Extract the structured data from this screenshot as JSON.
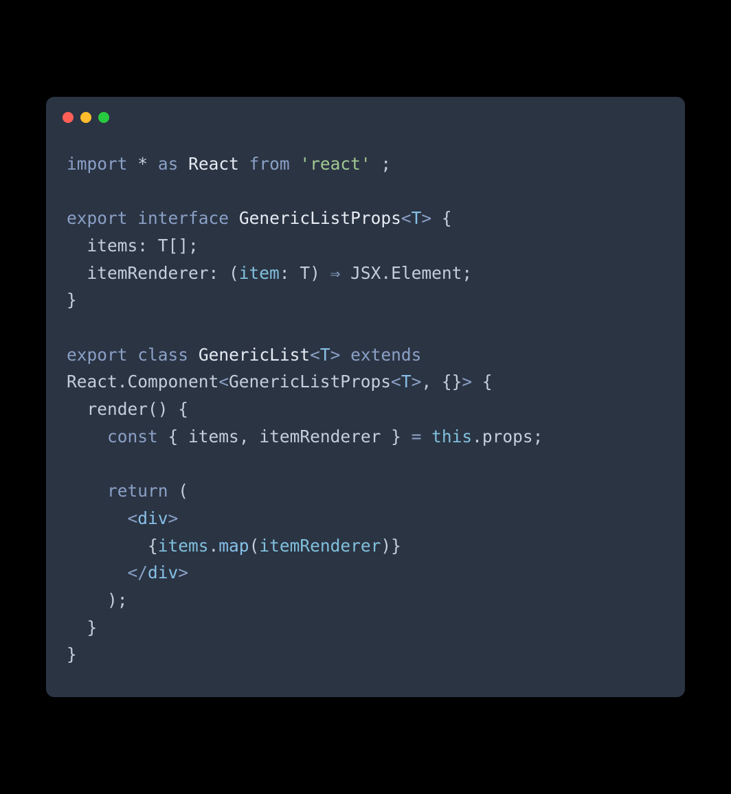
{
  "window": {
    "dots": {
      "red": "#ff5f56",
      "yellow": "#ffbd2e",
      "green": "#27c93f"
    }
  },
  "code": {
    "lines": [
      [
        {
          "t": "import",
          "c": "kw"
        },
        {
          "t": " ",
          "c": "pn"
        },
        {
          "t": "*",
          "c": "id2"
        },
        {
          "t": " ",
          "c": "pn"
        },
        {
          "t": "as",
          "c": "kw"
        },
        {
          "t": " ",
          "c": "pn"
        },
        {
          "t": "React",
          "c": "id"
        },
        {
          "t": " ",
          "c": "pn"
        },
        {
          "t": "from",
          "c": "kw"
        },
        {
          "t": " ",
          "c": "pn"
        },
        {
          "t": "'react'",
          "c": "str"
        },
        {
          "t": " ;",
          "c": "pn"
        }
      ],
      [],
      [
        {
          "t": "export",
          "c": "kw"
        },
        {
          "t": " ",
          "c": "pn"
        },
        {
          "t": "interface",
          "c": "kw"
        },
        {
          "t": " ",
          "c": "pn"
        },
        {
          "t": "GenericListProps",
          "c": "id"
        },
        {
          "t": "<",
          "c": "tagp"
        },
        {
          "t": "T",
          "c": "typ"
        },
        {
          "t": ">",
          "c": "tagp"
        },
        {
          "t": " {",
          "c": "par"
        }
      ],
      [
        {
          "t": "  items",
          "c": "id2"
        },
        {
          "t": ": ",
          "c": "pn"
        },
        {
          "t": "T",
          "c": "id2"
        },
        {
          "t": "[];",
          "c": "pn"
        }
      ],
      [
        {
          "t": "  itemRenderer",
          "c": "id2"
        },
        {
          "t": ": (",
          "c": "pn"
        },
        {
          "t": "item",
          "c": "tp"
        },
        {
          "t": ": ",
          "c": "pn"
        },
        {
          "t": "T",
          "c": "id2"
        },
        {
          "t": ") ",
          "c": "pn"
        },
        {
          "t": "⇒",
          "c": "op"
        },
        {
          "t": " JSX.Element;",
          "c": "id2"
        }
      ],
      [
        {
          "t": "}",
          "c": "par"
        }
      ],
      [],
      [
        {
          "t": "export",
          "c": "kw"
        },
        {
          "t": " ",
          "c": "pn"
        },
        {
          "t": "class",
          "c": "kw"
        },
        {
          "t": " ",
          "c": "pn"
        },
        {
          "t": "GenericList",
          "c": "id"
        },
        {
          "t": "<",
          "c": "tagp"
        },
        {
          "t": "T",
          "c": "typ"
        },
        {
          "t": ">",
          "c": "tagp"
        },
        {
          "t": " ",
          "c": "pn"
        },
        {
          "t": "extends",
          "c": "kw"
        }
      ],
      [
        {
          "t": "React.Component",
          "c": "id2"
        },
        {
          "t": "<",
          "c": "tagp"
        },
        {
          "t": "GenericListProps",
          "c": "id2"
        },
        {
          "t": "<",
          "c": "tagp"
        },
        {
          "t": "T",
          "c": "typ"
        },
        {
          "t": ">",
          "c": "tagp"
        },
        {
          "t": ", {}",
          "c": "id2"
        },
        {
          "t": ">",
          "c": "tagp"
        },
        {
          "t": " {",
          "c": "par"
        }
      ],
      [
        {
          "t": "  render",
          "c": "id2"
        },
        {
          "t": "() {",
          "c": "par"
        }
      ],
      [
        {
          "t": "    ",
          "c": "pn"
        },
        {
          "t": "const",
          "c": "kw"
        },
        {
          "t": " { ",
          "c": "par"
        },
        {
          "t": "items",
          "c": "id2"
        },
        {
          "t": ", ",
          "c": "pn"
        },
        {
          "t": "itemRenderer",
          "c": "id2"
        },
        {
          "t": " } ",
          "c": "par"
        },
        {
          "t": "=",
          "c": "op"
        },
        {
          "t": " ",
          "c": "pn"
        },
        {
          "t": "this",
          "c": "tp"
        },
        {
          "t": ".props;",
          "c": "id2"
        }
      ],
      [],
      [
        {
          "t": "    ",
          "c": "pn"
        },
        {
          "t": "return",
          "c": "kw"
        },
        {
          "t": " (",
          "c": "par"
        }
      ],
      [
        {
          "t": "      ",
          "c": "pn"
        },
        {
          "t": "<",
          "c": "tagp"
        },
        {
          "t": "div",
          "c": "tagn"
        },
        {
          "t": ">",
          "c": "tagp"
        }
      ],
      [
        {
          "t": "        {",
          "c": "par"
        },
        {
          "t": "items",
          "c": "tp"
        },
        {
          "t": ".",
          "c": "pn"
        },
        {
          "t": "map",
          "c": "fn"
        },
        {
          "t": "(",
          "c": "par"
        },
        {
          "t": "itemRenderer",
          "c": "tp"
        },
        {
          "t": ")",
          "c": "par"
        },
        {
          "t": "}",
          "c": "par"
        }
      ],
      [
        {
          "t": "      ",
          "c": "pn"
        },
        {
          "t": "</",
          "c": "tagp"
        },
        {
          "t": "div",
          "c": "tagn"
        },
        {
          "t": ">",
          "c": "tagp"
        }
      ],
      [
        {
          "t": "    );",
          "c": "par"
        }
      ],
      [
        {
          "t": "  }",
          "c": "par"
        }
      ],
      [
        {
          "t": "}",
          "c": "par"
        }
      ]
    ]
  }
}
